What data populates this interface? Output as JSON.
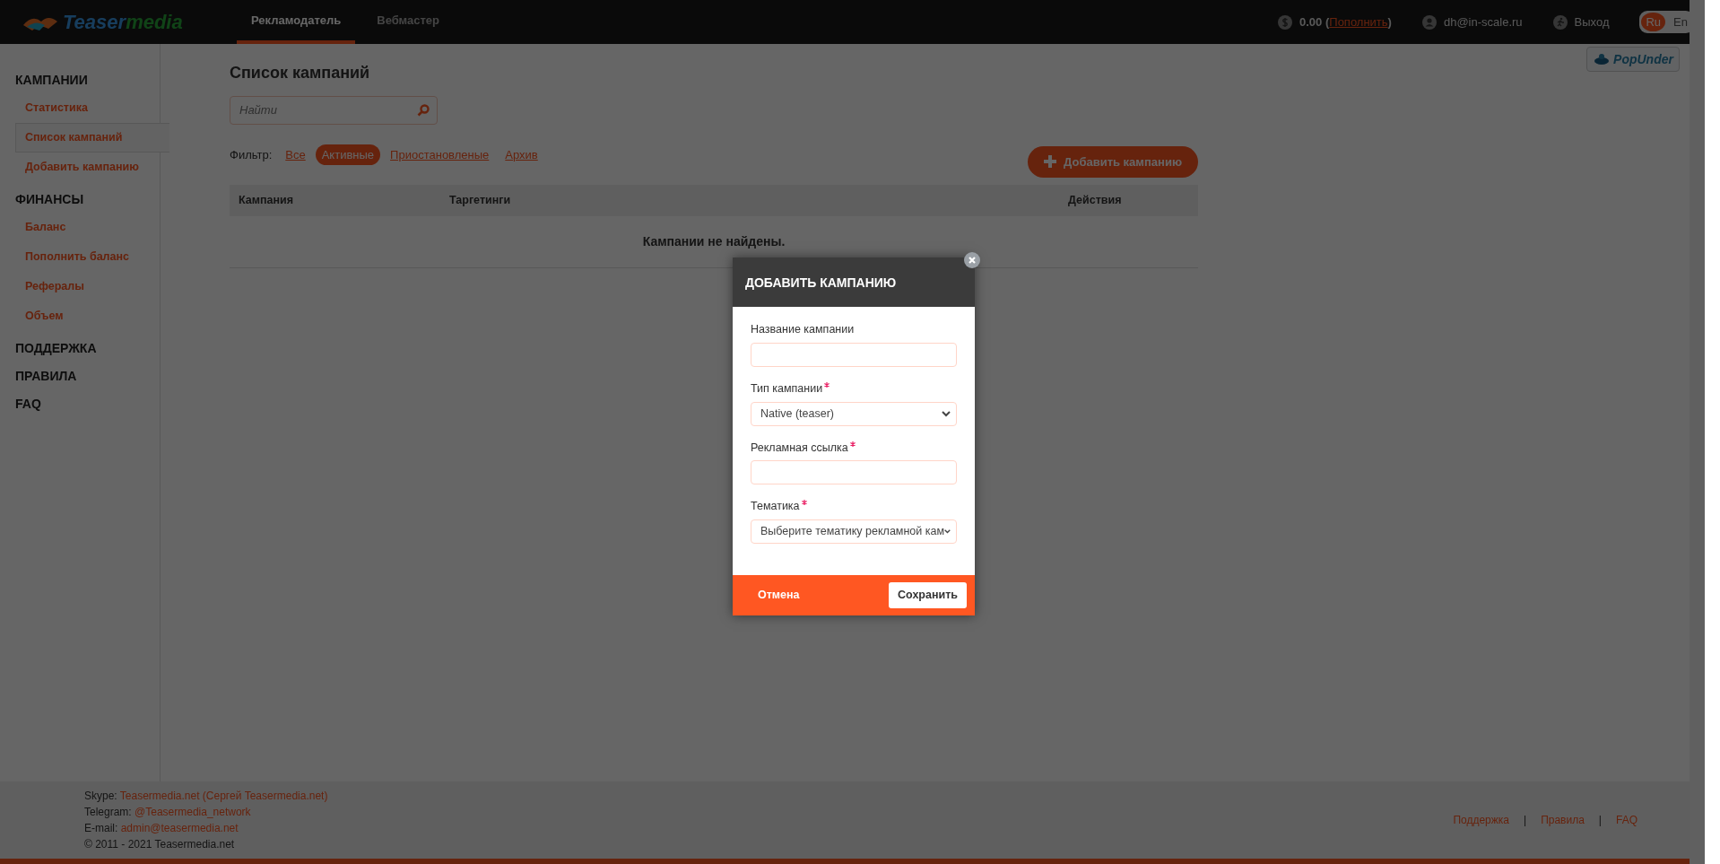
{
  "header": {
    "logo": {
      "part_1": "Teaser",
      "part_2": "media"
    },
    "tabs": [
      {
        "label": "Рекламодатель",
        "selected": true
      },
      {
        "label": "Вебмастер",
        "selected": false
      }
    ],
    "balance_prefix": "0.00 (",
    "topup_link": "Пополнить",
    "balance_suffix": ")",
    "user": "dh@in-scale.ru",
    "logout": "Выход",
    "languages": [
      {
        "label": "Ru",
        "selected": true
      },
      {
        "label": "En",
        "selected": false
      }
    ]
  },
  "banner": {
    "text": "PopUnder"
  },
  "sidebar": {
    "sections": [
      {
        "title": "КАМПАНИИ",
        "items": [
          {
            "label": "Статистика",
            "selected": false
          },
          {
            "label": "Список кампаний",
            "selected": true
          },
          {
            "label": "Добавить кампанию",
            "selected": false
          }
        ]
      },
      {
        "title": "ФИНАНСЫ",
        "items": [
          {
            "label": "Баланс",
            "selected": false
          },
          {
            "label": "Пополнить баланс",
            "selected": false
          },
          {
            "label": "Рефералы",
            "selected": false
          },
          {
            "label": "Объем",
            "selected": false
          }
        ]
      },
      {
        "title": "ПОДДЕРЖКА"
      },
      {
        "title": "ПРАВИЛА"
      },
      {
        "title": "FAQ"
      }
    ]
  },
  "content": {
    "title": "Список кампаний",
    "search": {
      "placeholder": "Найти"
    },
    "filter_label": "Фильтр:",
    "filters": [
      {
        "label": "Все",
        "selected": false
      },
      {
        "label": "Активные",
        "selected": true
      },
      {
        "label": "Приостановленые",
        "selected": false
      },
      {
        "label": "Архив",
        "selected": false
      }
    ],
    "add_button": "Добавить кампанию",
    "table": {
      "columns": [
        "Кампания",
        "Таргетинги",
        "Действия"
      ],
      "empty_message": "Кампании не найдены."
    }
  },
  "modal": {
    "title": "ДОБАВИТЬ КАМПАНИЮ",
    "fields": [
      {
        "label": "Название кампании",
        "required": false,
        "kind": "input"
      },
      {
        "label": "Тип кампании",
        "required": true,
        "kind": "select",
        "value": "Native (teaser)"
      },
      {
        "label": "Рекламная ссылка",
        "required": true,
        "kind": "input"
      },
      {
        "label": "Тематика",
        "required": true,
        "kind": "select",
        "value": "Выберите тематику рекламной кам"
      }
    ],
    "cancel": "Отмена",
    "save": "Сохранить"
  },
  "footer": {
    "contacts": [
      {
        "label": "Skype:",
        "value": "Teasermedia.net (Сергей Teasermedia.net)"
      },
      {
        "label": "Telegram:",
        "value": "@Teasermedia_network"
      },
      {
        "label": "E-mail:",
        "value": "admin@teasermedia.net"
      }
    ],
    "copyright": "© 2011 - 2021 Teasermedia.net",
    "links": [
      "Поддержка",
      "Правила",
      "FAQ"
    ],
    "separator": "|"
  }
}
